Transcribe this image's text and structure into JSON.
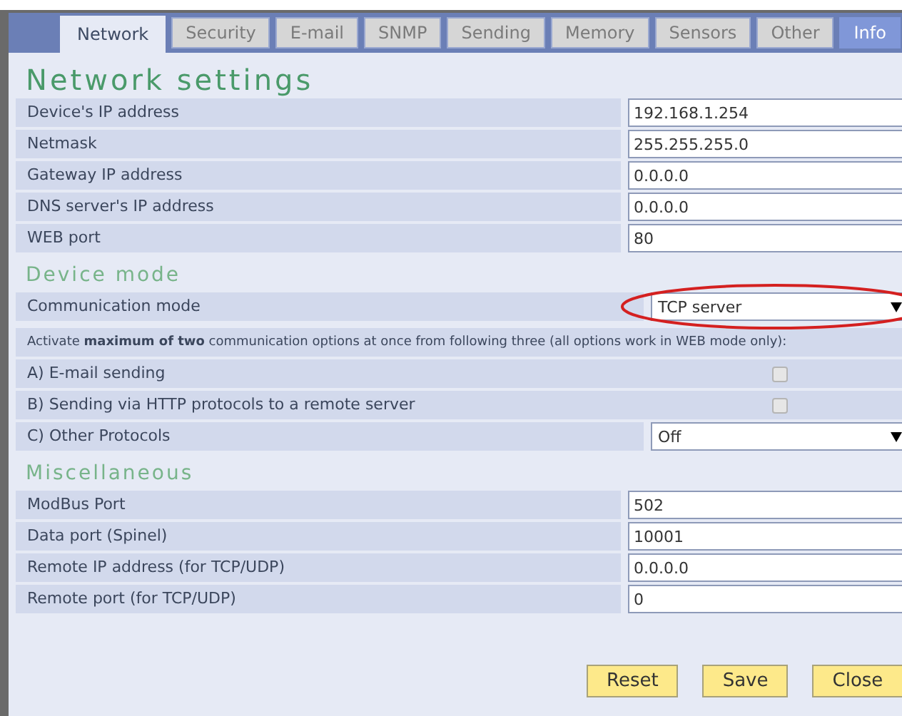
{
  "tabs": [
    {
      "label": "Network",
      "selected": true,
      "kind": "normal"
    },
    {
      "label": "Security",
      "selected": false,
      "kind": "normal"
    },
    {
      "label": "E-mail",
      "selected": false,
      "kind": "normal"
    },
    {
      "label": "SNMP",
      "selected": false,
      "kind": "normal"
    },
    {
      "label": "Sending",
      "selected": false,
      "kind": "normal"
    },
    {
      "label": "Memory",
      "selected": false,
      "kind": "normal"
    },
    {
      "label": "Sensors",
      "selected": false,
      "kind": "normal"
    },
    {
      "label": "Other",
      "selected": false,
      "kind": "normal"
    },
    {
      "label": "Info",
      "selected": false,
      "kind": "accent"
    }
  ],
  "sections": [
    {
      "heading": "Network settings",
      "kind": "title",
      "rows": [
        {
          "kind": "text",
          "label": "Device's IP address",
          "value": "192.168.1.254"
        },
        {
          "kind": "text",
          "label": "Netmask",
          "value": "255.255.255.0"
        },
        {
          "kind": "text",
          "label": "Gateway IP address",
          "value": "0.0.0.0"
        },
        {
          "kind": "text",
          "label": "DNS server's IP address",
          "value": "0.0.0.0"
        },
        {
          "kind": "text",
          "label": "WEB port",
          "value": "80"
        }
      ]
    },
    {
      "heading": "Device mode",
      "kind": "subtitle",
      "rows": [
        {
          "kind": "select",
          "label": "Communication mode",
          "value": "TCP server",
          "highlighted": true
        },
        {
          "kind": "note",
          "label": "Activate **maximum of two** communication options at once from following three (all options work in WEB mode only):"
        },
        {
          "kind": "checkbox",
          "label": "A) E-mail sending",
          "checked": false
        },
        {
          "kind": "checkbox",
          "label": "B) Sending via HTTP protocols to a remote server",
          "checked": false
        },
        {
          "kind": "select",
          "label": "C) Other Protocols",
          "value": "Off",
          "highlighted": false
        }
      ]
    },
    {
      "heading": "Miscellaneous",
      "kind": "subtitle",
      "rows": [
        {
          "kind": "text",
          "label": "ModBus Port",
          "value": "502"
        },
        {
          "kind": "text",
          "label": "Data port (Spinel)",
          "value": "10001"
        },
        {
          "kind": "text",
          "label": "Remote IP address (for TCP/UDP)",
          "value": "0.0.0.0"
        },
        {
          "kind": "text",
          "label": "Remote port (for TCP/UDP)",
          "value": "0"
        }
      ]
    }
  ],
  "buttons": [
    "Reset",
    "Save",
    "Close"
  ]
}
